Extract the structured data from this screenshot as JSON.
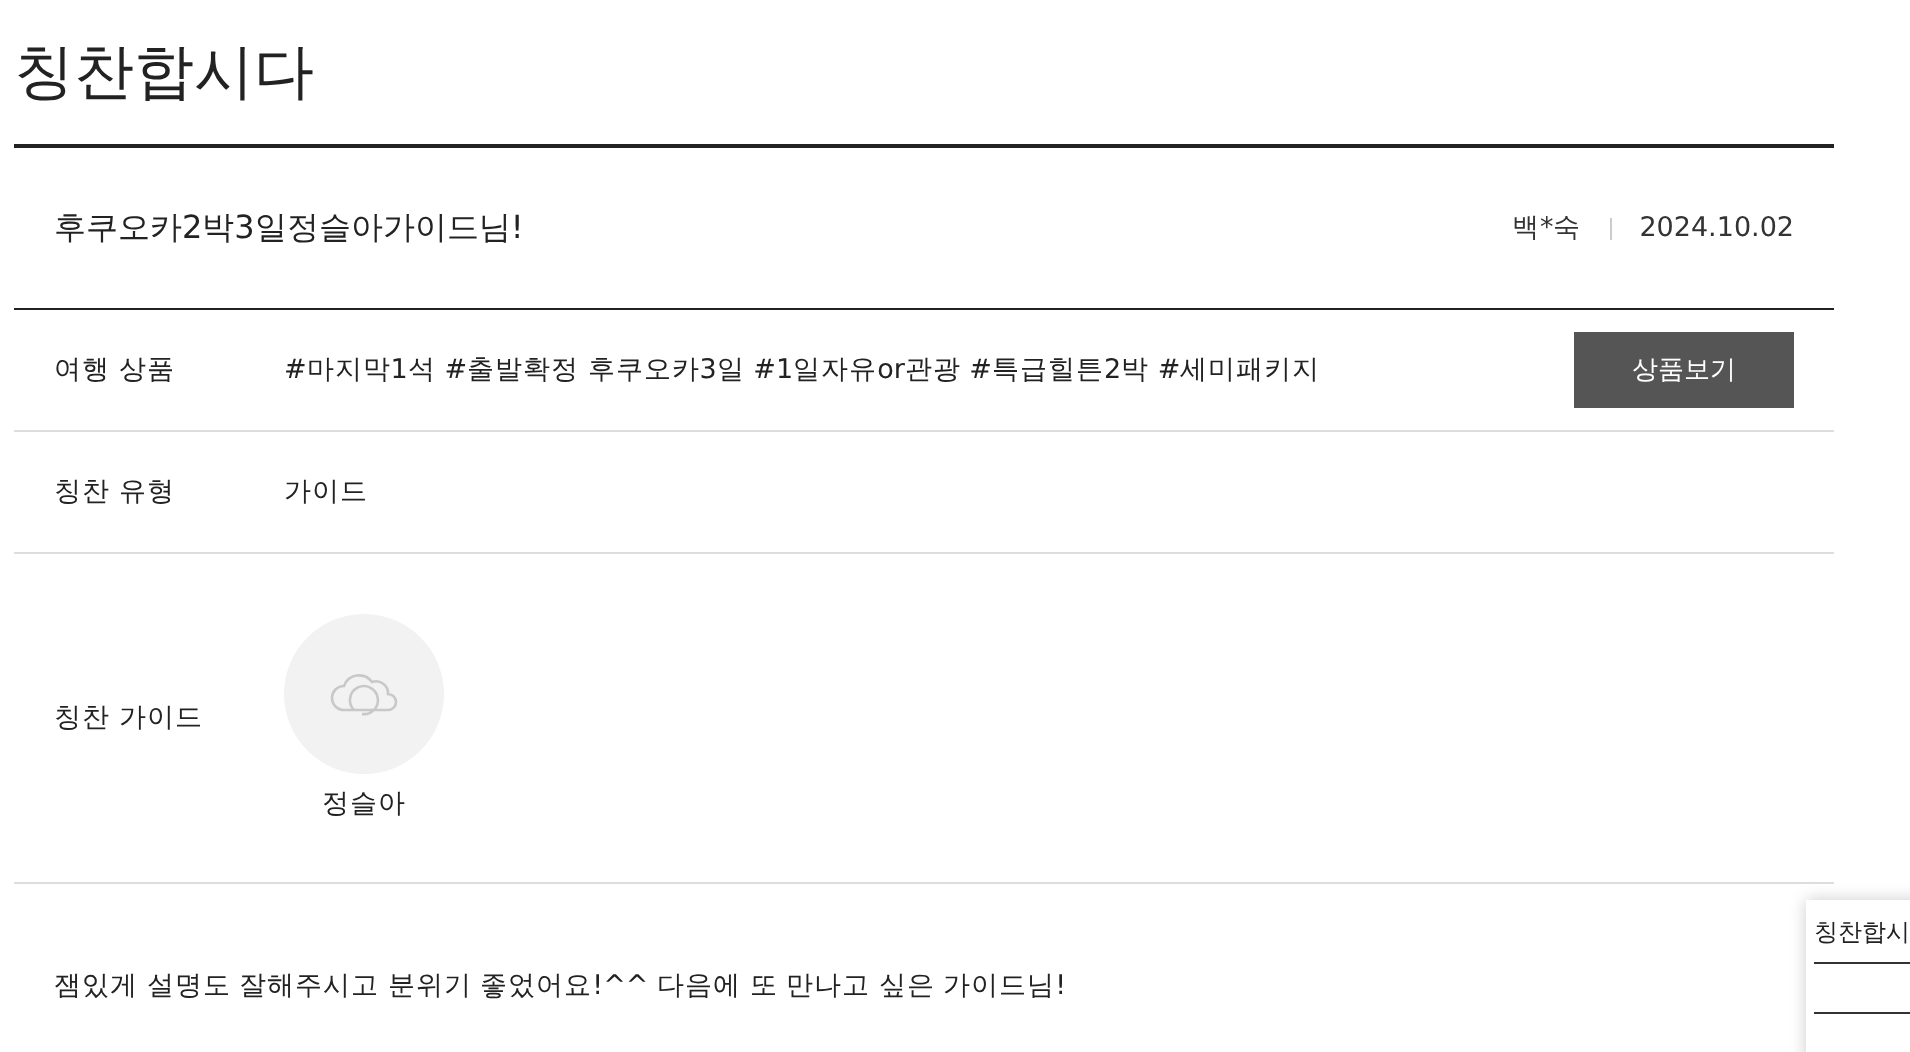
{
  "page_title": "칭찬합시다",
  "review": {
    "title": "후쿠오카2박3일정슬아가이드님!",
    "author": "백*숙",
    "date": "2024.10.02"
  },
  "rows": [
    {
      "kind": "product",
      "label": "여행 상품",
      "value": "#마지막1석 #출발확정 후쿠오카3일 #1일자유or관광 #특급힐튼2박 #세미패키지",
      "button": "상품보기"
    },
    {
      "kind": "text",
      "label": "칭찬 유형",
      "value": "가이드"
    },
    {
      "kind": "guide",
      "label": "칭찬 가이드",
      "name": "정슬아"
    }
  ],
  "body": "잼있게 설명도 잘해주시고 분위기 좋었어요!^^ 다음에 또 만나고 싶은 가이드님!",
  "preview": {
    "title": "칭찬합시"
  }
}
